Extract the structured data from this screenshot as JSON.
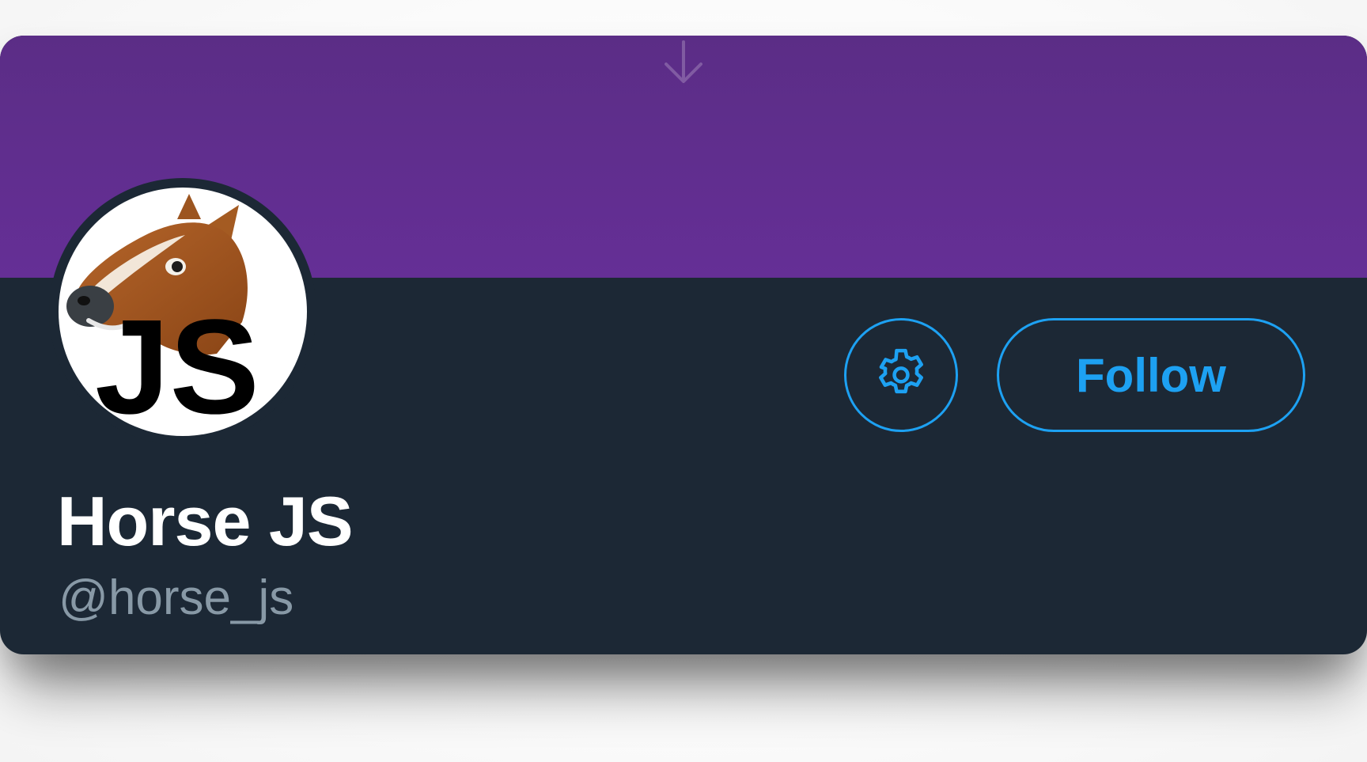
{
  "profile": {
    "display_name": "Horse JS",
    "handle": "@horse_js",
    "avatar_icon": "horse-head-js-avatar",
    "avatar_logo_text": "JS"
  },
  "actions": {
    "settings_icon": "gear-icon",
    "follow_label": "Follow"
  },
  "banner": {
    "icon": "arrow-down-icon"
  },
  "colors": {
    "banner": "#5e2d8c",
    "card_background": "#1c2835",
    "accent": "#1da1f2",
    "name_text": "#ffffff",
    "handle_text": "#8899a6"
  }
}
